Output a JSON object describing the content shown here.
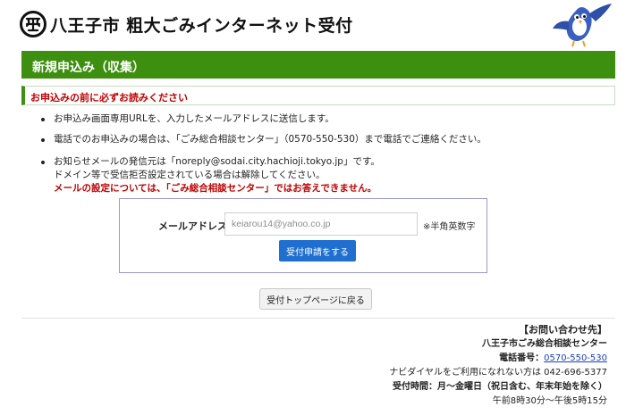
{
  "header": {
    "site_title": "八王子市 粗大ごみインターネット受付"
  },
  "page": {
    "heading": "新規申込み（収集）"
  },
  "notice": {
    "title": "お申込みの前に必ずお読みください",
    "bullets": [
      {
        "lines": [
          "お申込み画面専用URLを、入力したメールアドレスに送信します。"
        ]
      },
      {
        "lines": [
          "電話でのお申込みの場合は、「ごみ総合相談センター」（0570-550-530）まで電話でご連絡ください。"
        ]
      },
      {
        "lines": [
          "お知らせメールの発信元は「noreply@sodai.city.hachioji.tokyo.jp」です。",
          "ドメイン等で受信拒否設定されている場合は解除してください。"
        ],
        "warning": "メールの設定については、「ごみ総合相談センター」ではお答えできません。"
      }
    ]
  },
  "form": {
    "email_label": "メールアドレス",
    "email_placeholder": "keiarou14@yahoo.co.jp",
    "email_value": "",
    "email_note": "※半角英数字",
    "submit_label": "受付申請をする"
  },
  "nav": {
    "back_label": "受付トップページに戻る"
  },
  "contact": {
    "heading": "【お問い合わせ先】",
    "center_name": "八王子市ごみ総合相談センター",
    "phone_label": "電話番号：",
    "phone_number": "0570-550-530",
    "alt_phone": "ナビダイヤルをご利用になれない方は 042-696-5377",
    "hours_label": "受付時間：月～金曜日（祝日含む、年末年始を除く）",
    "hours_time": "午前8時30分～午後5時15分"
  },
  "colors": {
    "brand_green": "#3d8f0f",
    "warning_red": "#c00000",
    "primary_blue": "#1f6fd0",
    "link_blue": "#1a3fbf"
  },
  "icons": {
    "logo": "hachioji-city-emblem-icon",
    "mascot": "bird-mascot-icon"
  }
}
